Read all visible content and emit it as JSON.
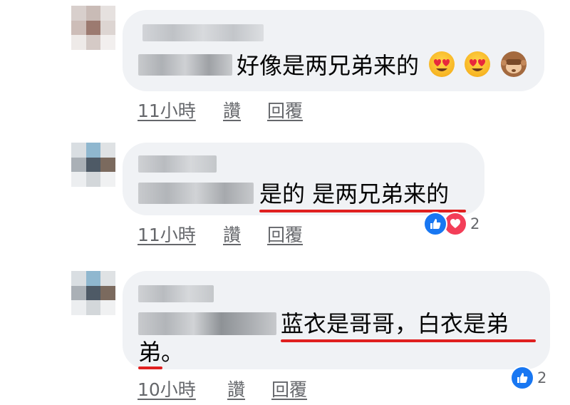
{
  "comments": [
    {
      "text": "好像是两兄弟来的",
      "emojis": [
        "heart-eyes",
        "heart-eyes",
        "see-no-evil-monkey"
      ],
      "actions": {
        "time": "11小時",
        "like": "讚",
        "reply": "回覆"
      },
      "reactions": null
    },
    {
      "text": "是的 是两兄弟来的",
      "actions": {
        "time": "11小時",
        "like": "讚",
        "reply": "回覆"
      },
      "reactions": {
        "types": [
          "like",
          "love"
        ],
        "count": "2"
      }
    },
    {
      "text_line1": "蓝衣是哥哥，白衣是弟",
      "text_line2_underlined": "弟",
      "text_line2_rest": "。",
      "actions": {
        "time": "10小時",
        "like": "讚",
        "reply": "回覆"
      },
      "reactions": {
        "types": [
          "like"
        ],
        "count": "2"
      }
    }
  ],
  "colors": {
    "bubble": "#f0f2f5",
    "underline": "#e02020",
    "meta": "#65676b",
    "like_blue": "#1877f2",
    "love_red": "#f33e58"
  }
}
